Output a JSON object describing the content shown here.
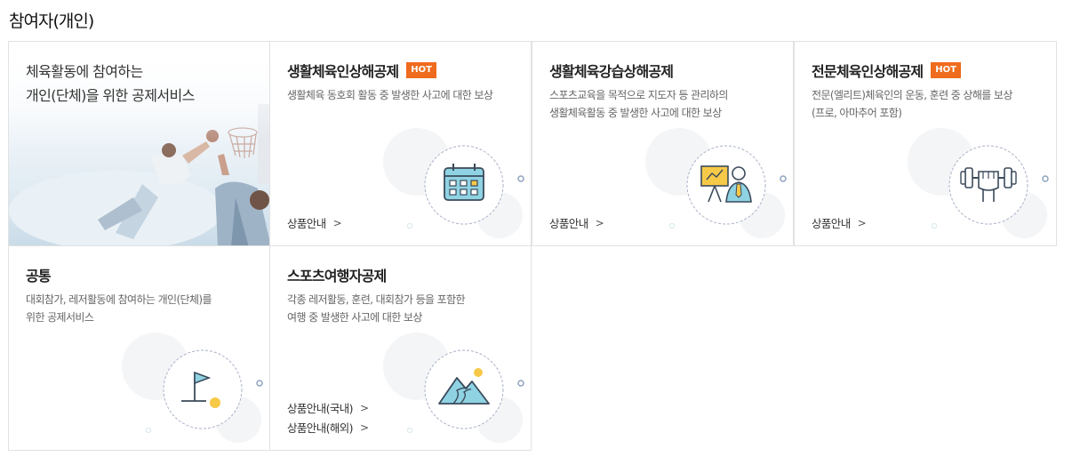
{
  "section": {
    "title": "참여자(개인)"
  },
  "intro": {
    "text": "체육활동에 참여하는\n개인(단체)을 위한 공제서비스"
  },
  "cards": [
    {
      "title": "생활체육인상해공제",
      "hot": "HOT",
      "desc": "생활체육 동호회 활동 중 발생한 사고에 대한 보상",
      "links": [
        "상품안내"
      ],
      "icon": "calendar-icon"
    },
    {
      "title": "생활체육강습상해공제",
      "hot": "",
      "desc": "스포츠교육을 목적으로 지도자 등 관리하의\n생활체육활동 중 발생한 사고에 대한 보상",
      "links": [
        "상품안내"
      ],
      "icon": "presenter-icon"
    },
    {
      "title": "전문체육인상해공제",
      "hot": "HOT",
      "desc": "전문(엘리트)체육인의 운동, 훈련 중 상해를 보상\n(프로, 아마추어 포함)",
      "links": [
        "상품안내"
      ],
      "icon": "dumbbell-fist-icon"
    },
    {
      "title": "공통",
      "hot": "",
      "desc": "대회참가, 레저활동에 참여하는 개인(단체)를\n위한 공제서비스",
      "links": [],
      "icon": "golf-flag-icon"
    },
    {
      "title": "스포츠여행자공제",
      "hot": "",
      "desc": "각종 레저활동, 훈련, 대회참가 등을 포함한\n여행 중 발생한 사고에 대한 보상",
      "links": [
        "상품안내(국내)",
        "상품안내(해외)"
      ],
      "icon": "mountain-icon"
    }
  ],
  "colors": {
    "hot": "#ef6b1d",
    "icon_fill": "#8fd3e3",
    "icon_accent": "#f7c948",
    "icon_stroke": "#3b4a5a"
  }
}
